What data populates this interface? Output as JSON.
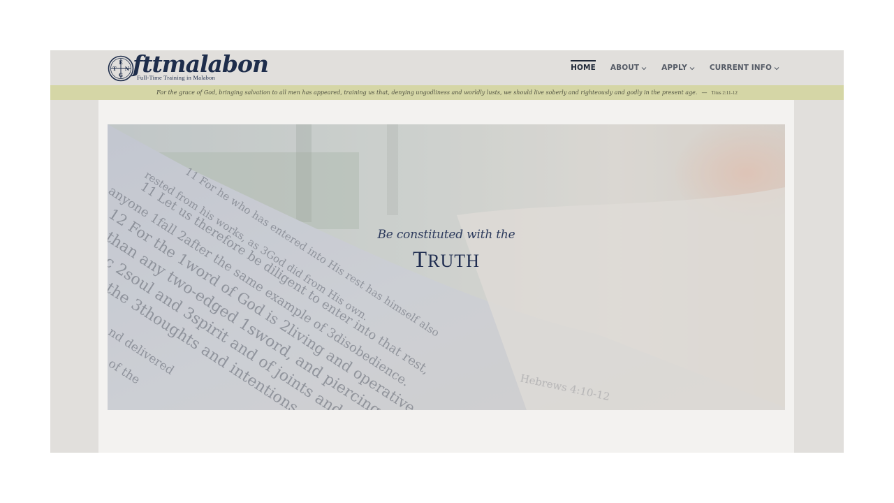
{
  "header": {
    "logo": {
      "wordmark": "fttmalabon",
      "tagline": "Full-Time Training in Malabon",
      "emblem_letters": [
        "E",
        "N",
        "T",
        "G"
      ]
    },
    "nav": [
      {
        "label": "HOME",
        "active": true,
        "has_dropdown": false
      },
      {
        "label": "ABOUT",
        "active": false,
        "has_dropdown": true
      },
      {
        "label": "APPLY",
        "active": false,
        "has_dropdown": true
      },
      {
        "label": "CURRENT INFO",
        "active": false,
        "has_dropdown": true
      }
    ]
  },
  "verse_banner": {
    "text": "For the grace of God, bringing salvation to all men has appeared, training us that, denying ungodliness and worldly lusts, we should live soberly and righteously and godly in the present age.",
    "dash": "—",
    "reference": "Titus 2:11-12"
  },
  "hero": {
    "subtitle": "Be constituted with the",
    "title": "Truth",
    "background_image": "open-bible-photo",
    "page_lines": [
      "11 For he who has entered into His rest has himself also",
      "rested from his works, as 3God did from His own.",
      "11 Let us therefore be diligent to enter into that rest,",
      "anyone 1fall 2after the same example of 3disobedience.",
      "12 For the 1word of God is 2living and operative",
      "than any two-edged 1sword, and piercing",
      "c 2soul and 3spirit and of joints and",
      "the 3thoughts and intentions",
      "nd delivered",
      "of the",
      "Hebrews 4:10-12"
    ]
  },
  "colors": {
    "site_bg": "#e1dfdc",
    "content_bg": "#f3f2f0",
    "banner_bg": "#d5d6a6",
    "brand_navy": "#1e2d4b",
    "nav_text": "#555b66"
  }
}
